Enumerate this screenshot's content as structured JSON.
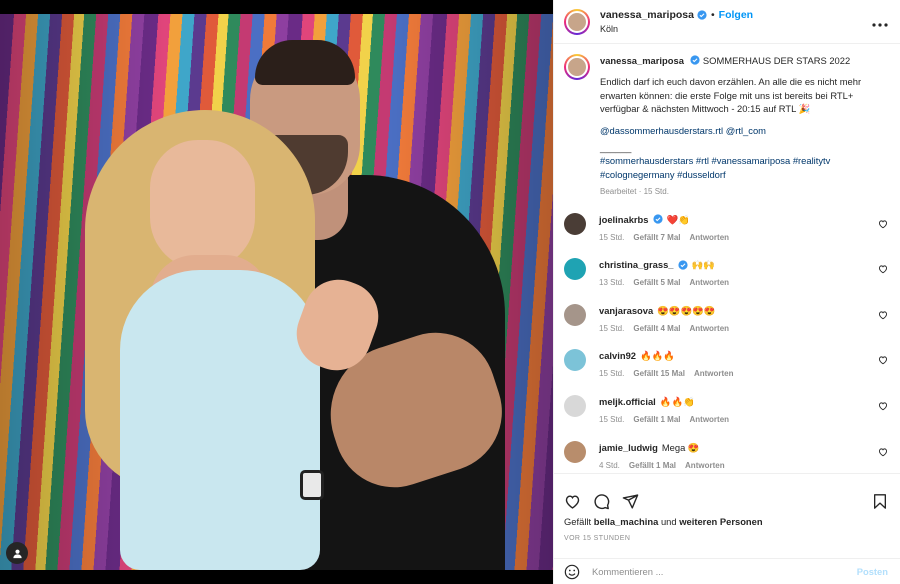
{
  "post": {
    "username": "vanessa_mariposa",
    "separator": "•",
    "follow_label": "Folgen",
    "location": "Köln",
    "more_icon": "more-horizontal-icon"
  },
  "caption": {
    "username": "vanessa_mariposa",
    "title": "SOMMERHAUS DER STARS 2022",
    "text": "Endlich darf ich euch davon erzählen. An alle die es nicht mehr erwarten können: die erste Folge mit uns ist bereits bei RTL+ verfügbar & nächsten Mittwoch - 20:15 auf RTL 🎉",
    "mentions": [
      "@dassommerhausderstars.rtl",
      "@rtl_com"
    ],
    "divider": "______",
    "hashtags": [
      "#sommerhausderstars",
      "#rtl",
      "#vanessamariposa",
      "#realitytv",
      "#colognegermany",
      "#dusseldorf"
    ],
    "meta": "Bearbeitet · 15 Std."
  },
  "comments": [
    {
      "username": "joelinakrbs",
      "verified": true,
      "text": "❤️👏",
      "time": "15 Std.",
      "likes": "Gefällt 7 Mal",
      "reply": "Antworten",
      "avatar_color": "#4a3d36"
    },
    {
      "username": "christina_grass_",
      "verified": true,
      "text": "🙌🙌",
      "time": "13 Std.",
      "likes": "Gefällt 5 Mal",
      "reply": "Antworten",
      "avatar_color": "#1fa3b3"
    },
    {
      "username": "vanjarasova",
      "verified": false,
      "text": "😍😍😍😍😍",
      "time": "15 Std.",
      "likes": "Gefällt 4 Mal",
      "reply": "Antworten",
      "avatar_color": "#a5958a"
    },
    {
      "username": "calvin92",
      "verified": false,
      "text": "🔥🔥🔥",
      "time": "15 Std.",
      "likes": "Gefällt 15 Mal",
      "reply": "Antworten",
      "avatar_color": "#7cc3d8"
    },
    {
      "username": "meljk.official",
      "verified": false,
      "text": "🔥🔥👏",
      "time": "15 Std.",
      "likes": "Gefällt 1 Mal",
      "reply": "Antworten",
      "avatar_color": "#d8d8d8"
    },
    {
      "username": "jamie_ludwig",
      "verified": false,
      "text": "Mega 😍",
      "time": "4 Std.",
      "likes": "Gefällt 1 Mal",
      "reply": "Antworten",
      "avatar_color": "#b88d6c"
    }
  ],
  "actions": {
    "like_icon": "heart-icon",
    "comment_icon": "comment-icon",
    "share_icon": "send-icon",
    "save_icon": "bookmark-icon"
  },
  "likes": {
    "prefix": "Gefällt",
    "user": "bella_machina",
    "middle": "und",
    "others": "weiteren Personen"
  },
  "timestamp": "VOR 15 STUNDEN",
  "comment_box": {
    "placeholder": "Kommentieren ...",
    "post_label": "Posten",
    "emoji_icon": "smiley-icon"
  },
  "colors": {
    "accent": "#0095f6",
    "verified": "#3897f0",
    "muted": "#8e8e8e",
    "link": "#00376b"
  }
}
